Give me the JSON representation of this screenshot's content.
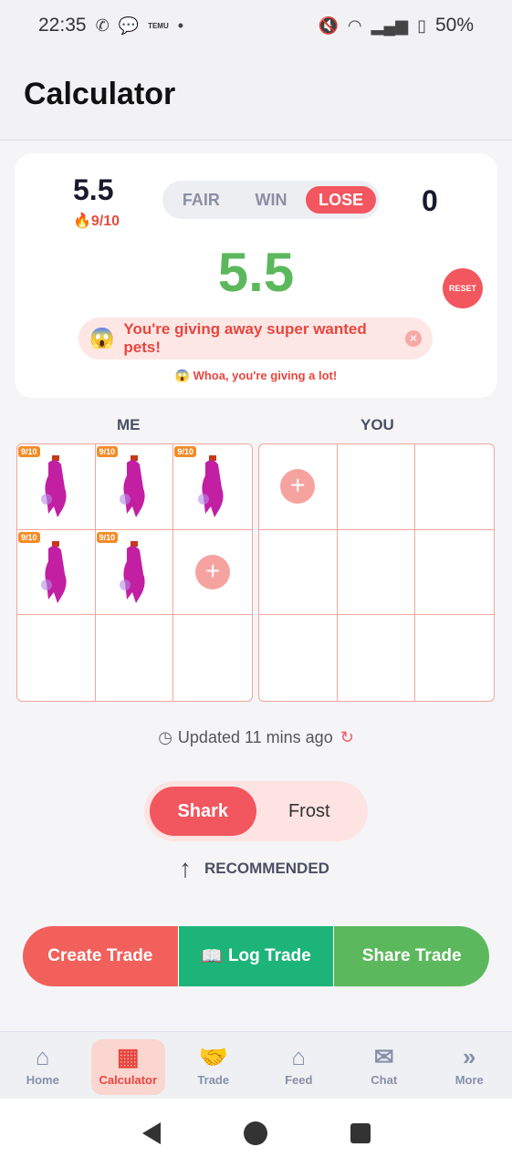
{
  "status_bar": {
    "time": "22:35",
    "temu": "TEMU",
    "dot": "•",
    "battery": "50%"
  },
  "header": {
    "title": "Calculator"
  },
  "summary": {
    "me_value": "5.5",
    "me_demand": "🔥9/10",
    "you_value": "0",
    "toggle": [
      "FAIR",
      "WIN",
      "LOSE"
    ],
    "toggle_active": "LOSE",
    "result_value": "5.5",
    "reset_label": "RESET",
    "warning_emoji": "😱",
    "warning_text": "You're giving away super wanted pets!",
    "sub_warning": "😱 Whoa, you're giving a lot!"
  },
  "grids": {
    "me_label": "ME",
    "you_label": "YOU",
    "me_badges": [
      "9/10",
      "9/10",
      "9/10",
      "9/10",
      "9/10"
    ],
    "add_symbol": "+"
  },
  "updated": {
    "text": "Updated 11 mins ago"
  },
  "mode": {
    "options": [
      "Shark",
      "Frost"
    ],
    "active": "Shark",
    "recommended": "RECOMMENDED"
  },
  "actions": {
    "create": "Create Trade",
    "log": "Log Trade",
    "share": "Share Trade"
  },
  "nav": {
    "items": [
      "Home",
      "Calculator",
      "Trade",
      "Feed",
      "Chat",
      "More"
    ],
    "active": "Calculator"
  },
  "colors": {
    "accent": "#f2565e",
    "win_green": "#5cb85c",
    "log_green": "#1db47a",
    "badge_orange": "#f28c28"
  }
}
